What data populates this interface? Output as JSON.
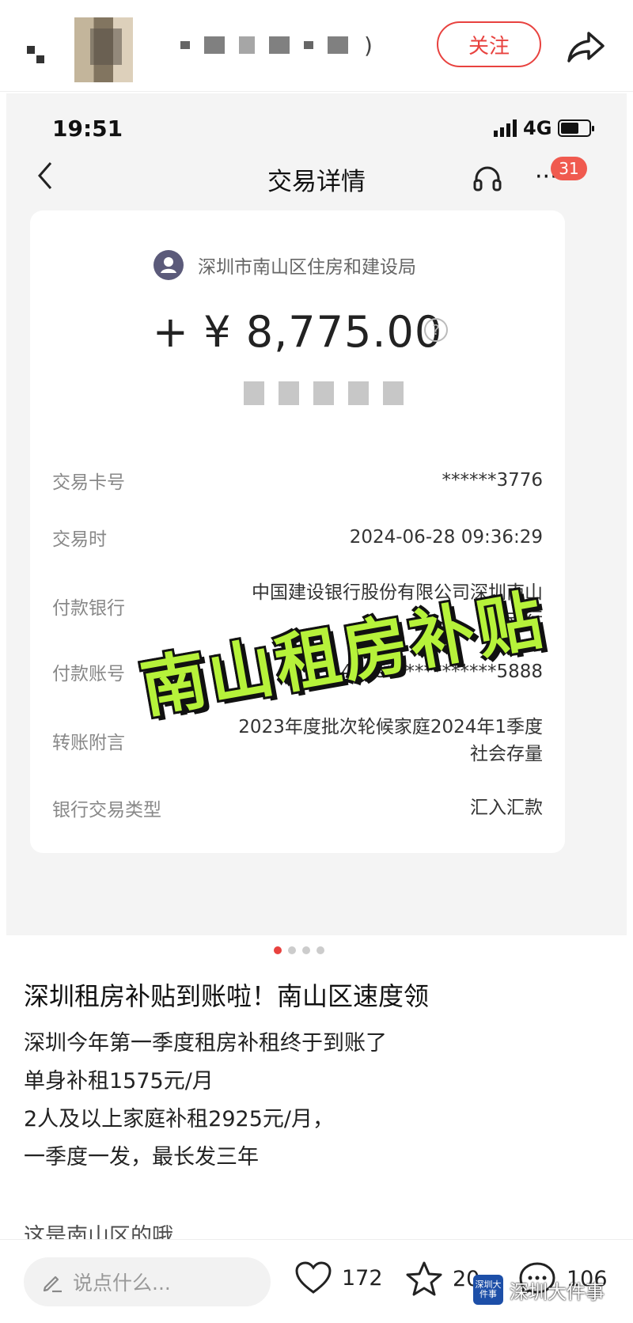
{
  "header": {
    "follow_label": "关注",
    "username_suffix": ")"
  },
  "phone": {
    "status_time": "19:51",
    "network": "4G",
    "nav_title": "交易详情",
    "badge_count": "31"
  },
  "transaction": {
    "payer": "深圳市南山区住房和建设局",
    "amount": "+ ¥ 8,775.00",
    "help_symbol": "?",
    "rows": [
      {
        "key": "交易卡号",
        "value": "******3776"
      },
      {
        "key": "交易时",
        "value": "2024-06-28 09:36:29"
      },
      {
        "key": "付款银行",
        "value": "中国建设银行股份有限公司深圳南山支行"
      },
      {
        "key": "付款账号",
        "value": "4425************5888"
      },
      {
        "key": "转账附言",
        "value": "2023年度批次轮候家庭2024年1季度社会存量"
      },
      {
        "key": "银行交易类型",
        "value": "汇入汇款"
      }
    ],
    "sticker": "南山租房补贴"
  },
  "post": {
    "title": "深圳租房补贴到账啦！南山区速度领",
    "lines": [
      "深圳今年第一季度租房补租终于到账了",
      "单身补租1575元/月",
      "2人及以上家庭补租2925元/月，",
      "一季度一发，最长发三年",
      "这是南山区的哦"
    ]
  },
  "bottom": {
    "comment_placeholder": "说点什么...",
    "likes": "172",
    "favorites": "20",
    "comments": "106",
    "watermark_text": "深圳大件事",
    "watermark_logo": "深圳大件事"
  },
  "colors": {
    "accent": "#e8423f",
    "sticker_fill": "#b6f23a",
    "badge": "#f05a4f"
  }
}
